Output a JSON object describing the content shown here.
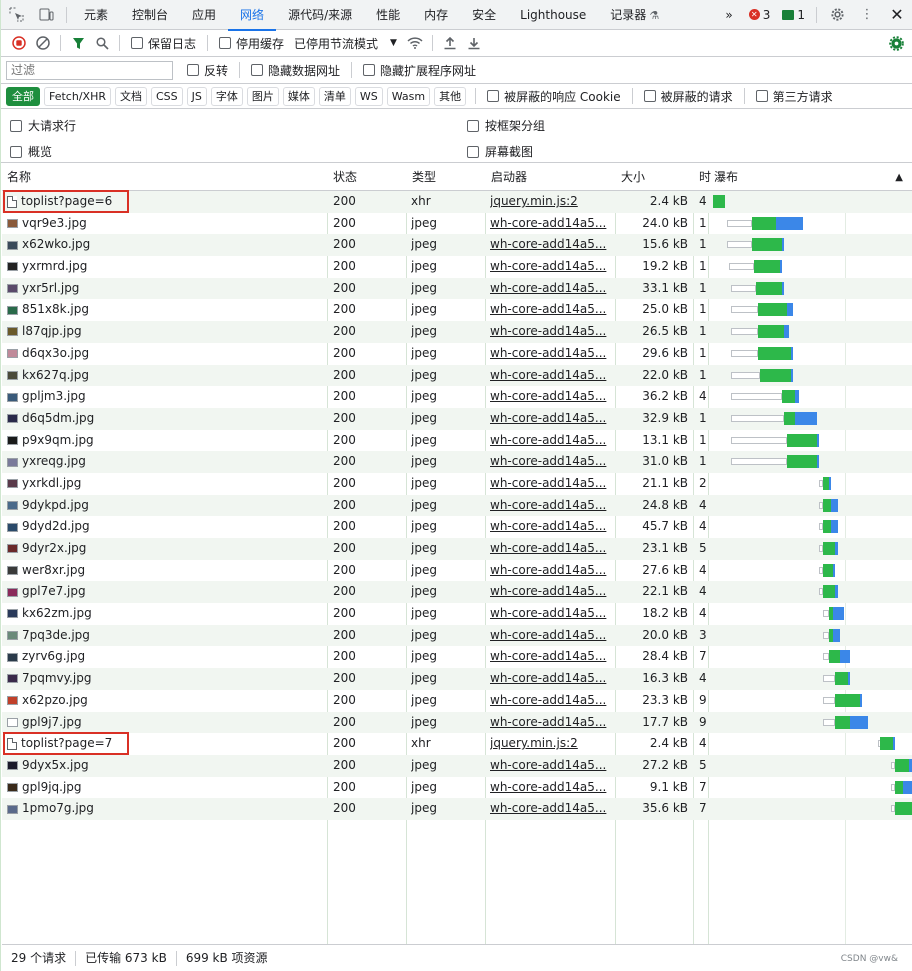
{
  "tabbar": {
    "tabs": [
      "元素",
      "控制台",
      "应用",
      "网络",
      "源代码/来源",
      "性能",
      "内存",
      "安全",
      "Lighthouse",
      "记录器"
    ],
    "active_tab": "网络",
    "more": "»",
    "error_count": "3",
    "message_count": "1"
  },
  "toolbar": {
    "preserve_log": "保留日志",
    "disable_cache": "停用缓存",
    "throttle": "已停用节流模式"
  },
  "filter": {
    "placeholder": "过滤",
    "invert": "反转",
    "hide_data_urls": "隐藏数据网址",
    "hide_extension_urls": "隐藏扩展程序网址"
  },
  "types": [
    "全部",
    "Fetch/XHR",
    "文档",
    "CSS",
    "JS",
    "字体",
    "图片",
    "媒体",
    "清单",
    "WS",
    "Wasm",
    "其他"
  ],
  "type_options": {
    "blocked_cookies": "被屏蔽的响应 Cookie",
    "blocked_requests": "被屏蔽的请求",
    "third_party": "第三方请求"
  },
  "options": {
    "big_rows": "大请求行",
    "group_by_frame": "按框架分组",
    "overview": "概览",
    "screenshots": "屏幕截图"
  },
  "columns": {
    "name": "名称",
    "status": "状态",
    "type": "类型",
    "initiator": "启动器",
    "size": "大小",
    "time": "时",
    "waterfall": "瀑布"
  },
  "colors": {
    "accent": "#1a73e8",
    "green_bar": "#2db84a",
    "blue_bar": "#3b87e8",
    "highlight": "#d93025"
  },
  "rows": [
    {
      "name": "toplist?page=6",
      "status": "200",
      "type": "xhr",
      "initiator": "jquery.min.js:2",
      "size": "2.4 kB",
      "time": "4.",
      "kind": "doc",
      "highlight": true,
      "wf": [
        0.02,
        0.0,
        0.06,
        0.0
      ]
    },
    {
      "name": "vqr9e3.jpg",
      "status": "200",
      "type": "jpeg",
      "initiator": "wh-core-add14a5...",
      "size": "24.0 kB",
      "time": "1.",
      "kind": "img",
      "thumb": "#8a5a3a",
      "wf": [
        0.09,
        0.12,
        0.12,
        0.13
      ]
    },
    {
      "name": "x62wko.jpg",
      "status": "200",
      "type": "jpeg",
      "initiator": "wh-core-add14a5...",
      "size": "15.6 kB",
      "time": "1.",
      "kind": "img",
      "thumb": "#3a4a5a",
      "wf": [
        0.09,
        0.12,
        0.15,
        0.01
      ]
    },
    {
      "name": "yxrmrd.jpg",
      "status": "200",
      "type": "jpeg",
      "initiator": "wh-core-add14a5...",
      "size": "19.2 kB",
      "time": "1.",
      "kind": "img",
      "thumb": "#222222",
      "wf": [
        0.1,
        0.12,
        0.13,
        0.01
      ]
    },
    {
      "name": "yxr5rl.jpg",
      "status": "200",
      "type": "jpeg",
      "initiator": "wh-core-add14a5...",
      "size": "33.1 kB",
      "time": "1.",
      "kind": "img",
      "thumb": "#5a4a6a",
      "wf": [
        0.11,
        0.12,
        0.13,
        0.01
      ]
    },
    {
      "name": "851x8k.jpg",
      "status": "200",
      "type": "jpeg",
      "initiator": "wh-core-add14a5...",
      "size": "25.0 kB",
      "time": "1.",
      "kind": "img",
      "thumb": "#2a6a4a",
      "wf": [
        0.11,
        0.13,
        0.14,
        0.03
      ]
    },
    {
      "name": "l87qjp.jpg",
      "status": "200",
      "type": "jpeg",
      "initiator": "wh-core-add14a5...",
      "size": "26.5 kB",
      "time": "1.",
      "kind": "img",
      "thumb": "#6a5a2a",
      "wf": [
        0.11,
        0.13,
        0.13,
        0.02
      ]
    },
    {
      "name": "d6qx3o.jpg",
      "status": "200",
      "type": "jpeg",
      "initiator": "wh-core-add14a5...",
      "size": "29.6 kB",
      "time": "1.",
      "kind": "img",
      "thumb": "#c08a9a",
      "wf": [
        0.11,
        0.13,
        0.16,
        0.01
      ]
    },
    {
      "name": "kx627q.jpg",
      "status": "200",
      "type": "jpeg",
      "initiator": "wh-core-add14a5...",
      "size": "22.0 kB",
      "time": "1.",
      "kind": "img",
      "thumb": "#4a4a3a",
      "wf": [
        0.11,
        0.14,
        0.15,
        0.01
      ]
    },
    {
      "name": "gpljm3.jpg",
      "status": "200",
      "type": "jpeg",
      "initiator": "wh-core-add14a5...",
      "size": "36.2 kB",
      "time": "4.",
      "kind": "img",
      "thumb": "#3a5a7a",
      "wf": [
        0.11,
        0.25,
        0.06,
        0.02
      ]
    },
    {
      "name": "d6q5dm.jpg",
      "status": "200",
      "type": "jpeg",
      "initiator": "wh-core-add14a5...",
      "size": "32.9 kB",
      "time": "1.",
      "kind": "img",
      "thumb": "#2a2a4a",
      "wf": [
        0.11,
        0.26,
        0.05,
        0.11
      ]
    },
    {
      "name": "p9x9qm.jpg",
      "status": "200",
      "type": "jpeg",
      "initiator": "wh-core-add14a5...",
      "size": "13.1 kB",
      "time": "1.",
      "kind": "img",
      "thumb": "#1a1a1a",
      "wf": [
        0.11,
        0.27,
        0.15,
        0.01
      ]
    },
    {
      "name": "yxreqg.jpg",
      "status": "200",
      "type": "jpeg",
      "initiator": "wh-core-add14a5...",
      "size": "31.0 kB",
      "time": "1.",
      "kind": "img",
      "thumb": "#7a7a9a",
      "wf": [
        0.11,
        0.27,
        0.15,
        0.01
      ]
    },
    {
      "name": "yxrkdl.jpg",
      "status": "200",
      "type": "jpeg",
      "initiator": "wh-core-add14a5...",
      "size": "21.1 kB",
      "time": "2.",
      "kind": "img",
      "thumb": "#5a3a4a",
      "wf": [
        0.54,
        0.02,
        0.03,
        0.01
      ]
    },
    {
      "name": "9dykpd.jpg",
      "status": "200",
      "type": "jpeg",
      "initiator": "wh-core-add14a5...",
      "size": "24.8 kB",
      "time": "4.",
      "kind": "img",
      "thumb": "#4a6a8a",
      "wf": [
        0.54,
        0.02,
        0.04,
        0.03
      ]
    },
    {
      "name": "9dyd2d.jpg",
      "status": "200",
      "type": "jpeg",
      "initiator": "wh-core-add14a5...",
      "size": "45.7 kB",
      "time": "4.",
      "kind": "img",
      "thumb": "#2a4a6a",
      "wf": [
        0.54,
        0.02,
        0.04,
        0.03
      ]
    },
    {
      "name": "9dyr2x.jpg",
      "status": "200",
      "type": "jpeg",
      "initiator": "wh-core-add14a5...",
      "size": "23.1 kB",
      "time": "5.",
      "kind": "img",
      "thumb": "#6a2a2a",
      "wf": [
        0.54,
        0.02,
        0.06,
        0.01
      ]
    },
    {
      "name": "wer8xr.jpg",
      "status": "200",
      "type": "jpeg",
      "initiator": "wh-core-add14a5...",
      "size": "27.6 kB",
      "time": "4.",
      "kind": "img",
      "thumb": "#3a3a3a",
      "wf": [
        0.54,
        0.02,
        0.05,
        0.01
      ]
    },
    {
      "name": "gpl7e7.jpg",
      "status": "200",
      "type": "jpeg",
      "initiator": "wh-core-add14a5...",
      "size": "22.1 kB",
      "time": "4.",
      "kind": "img",
      "thumb": "#8a2a5a",
      "wf": [
        0.54,
        0.02,
        0.06,
        0.01
      ]
    },
    {
      "name": "kx62zm.jpg",
      "status": "200",
      "type": "jpeg",
      "initiator": "wh-core-add14a5...",
      "size": "18.2 kB",
      "time": "4.",
      "kind": "img",
      "thumb": "#2a3a5a",
      "wf": [
        0.56,
        0.03,
        0.02,
        0.05
      ]
    },
    {
      "name": "7pq3de.jpg",
      "status": "200",
      "type": "jpeg",
      "initiator": "wh-core-add14a5...",
      "size": "20.0 kB",
      "time": "3.",
      "kind": "img",
      "thumb": "#6a8a7a",
      "wf": [
        0.56,
        0.03,
        0.02,
        0.03
      ]
    },
    {
      "name": "zyrv6g.jpg",
      "status": "200",
      "type": "jpeg",
      "initiator": "wh-core-add14a5...",
      "size": "28.4 kB",
      "time": "7.",
      "kind": "img",
      "thumb": "#2a3a4a",
      "wf": [
        0.56,
        0.03,
        0.05,
        0.05
      ]
    },
    {
      "name": "7pqmvy.jpg",
      "status": "200",
      "type": "jpeg",
      "initiator": "wh-core-add14a5...",
      "size": "16.3 kB",
      "time": "4.",
      "kind": "img",
      "thumb": "#3a2a4a",
      "wf": [
        0.56,
        0.06,
        0.06,
        0.01
      ]
    },
    {
      "name": "x62pzo.jpg",
      "status": "200",
      "type": "jpeg",
      "initiator": "wh-core-add14a5...",
      "size": "23.3 kB",
      "time": "9.",
      "kind": "img",
      "thumb": "#c0402a",
      "wf": [
        0.56,
        0.06,
        0.12,
        0.01
      ]
    },
    {
      "name": "gpl9j7.jpg",
      "status": "200",
      "type": "jpeg",
      "initiator": "wh-core-add14a5...",
      "size": "17.7 kB",
      "time": "9.",
      "kind": "img",
      "thumb": "#ffffff",
      "wf": [
        0.56,
        0.06,
        0.07,
        0.09
      ]
    },
    {
      "name": "toplist?page=7",
      "status": "200",
      "type": "xhr",
      "initiator": "jquery.min.js:2",
      "size": "2.4 kB",
      "time": "4.",
      "kind": "doc",
      "highlight": true,
      "wf": [
        0.83,
        0.01,
        0.06,
        0.01
      ]
    },
    {
      "name": "9dyx5x.jpg",
      "status": "200",
      "type": "jpeg",
      "initiator": "wh-core-add14a5...",
      "size": "27.2 kB",
      "time": "5.",
      "kind": "img",
      "thumb": "#1a1a2a",
      "wf": [
        0.89,
        0.02,
        0.07,
        0.02
      ]
    },
    {
      "name": "gpl9jq.jpg",
      "status": "200",
      "type": "jpeg",
      "initiator": "wh-core-add14a5...",
      "size": "9.1 kB",
      "time": "7.",
      "kind": "img",
      "thumb": "#3a2a1a",
      "wf": [
        0.89,
        0.02,
        0.04,
        0.06
      ]
    },
    {
      "name": "1pmo7g.jpg",
      "status": "200",
      "type": "jpeg",
      "initiator": "wh-core-add14a5...",
      "size": "35.6 kB",
      "time": "7.",
      "kind": "img",
      "thumb": "#5a6a8a",
      "wf": [
        0.89,
        0.02,
        0.09,
        0.0
      ]
    }
  ],
  "status_bar": {
    "requests": "29 个请求",
    "transferred": "已传输 673 kB",
    "resources": "699 kB 项资源"
  },
  "watermark": "CSDN @vw&"
}
